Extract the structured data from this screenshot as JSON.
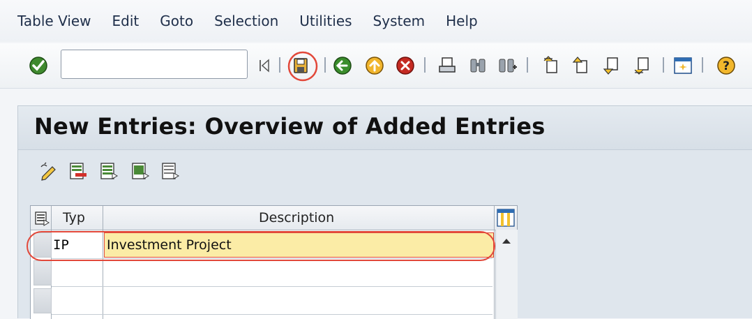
{
  "menu": {
    "items": [
      {
        "label": "Table View"
      },
      {
        "label": "Edit"
      },
      {
        "label": "Goto"
      },
      {
        "label": "Selection"
      },
      {
        "label": "Utilities"
      },
      {
        "label": "System"
      },
      {
        "label": "Help"
      }
    ]
  },
  "toolbar": {
    "command_field_value": "",
    "icons": [
      "enter-icon",
      "save-icon",
      "back-icon",
      "exit-icon",
      "cancel-icon",
      "print-icon",
      "find-icon",
      "find-next-icon",
      "first-page-icon",
      "previous-page-icon",
      "next-page-icon",
      "last-page-icon",
      "layout-icon",
      "help-icon"
    ],
    "save_highlighted": true
  },
  "page": {
    "title": "New Entries: Overview of Added Entries"
  },
  "app_toolbar": {
    "icons": [
      "change-display-icon",
      "delete-icon",
      "select-all-icon",
      "select-block-icon",
      "deselect-all-icon"
    ]
  },
  "table": {
    "columns": [
      {
        "label": "Typ"
      },
      {
        "label": "Description"
      }
    ],
    "rows": [
      {
        "typ": "IP",
        "description": "Investment Project"
      },
      {
        "typ": "",
        "description": ""
      },
      {
        "typ": "",
        "description": ""
      }
    ]
  },
  "colors": {
    "highlight": "#e2483a",
    "selected_row": "#fbeca6",
    "title_bg": "#dbe2ea"
  }
}
